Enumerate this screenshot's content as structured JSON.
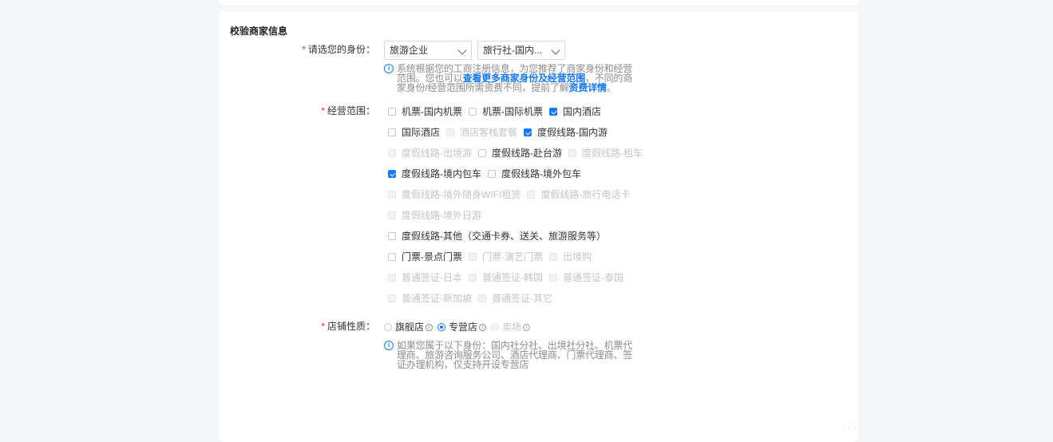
{
  "section_title": "校验商家信息",
  "identity": {
    "label": "请选您的身份：",
    "select1": "旅游企业",
    "select2": "旅行社-国内...",
    "hint_prefix": "系统根据您的工商注册信息，为您推荐了商家身份和经营范围。您也可以",
    "hint_link": "查看更多商家身份及经营范围",
    "hint_mid": "，不同的商家身份/经营范围所需资费不同，提前了解",
    "hint_link2": "资费详情",
    "hint_suffix": "。"
  },
  "scope": {
    "label": "经营范围：",
    "rows": [
      [
        {
          "label": "机票-国内机票",
          "checked": false,
          "disabled": false
        },
        {
          "label": "机票-国际机票",
          "checked": false,
          "disabled": false
        },
        {
          "label": "国内酒店",
          "checked": true,
          "disabled": false
        }
      ],
      [
        {
          "label": "国际酒店",
          "checked": false,
          "disabled": false
        },
        {
          "label": "酒店客栈套餐",
          "checked": false,
          "disabled": true
        },
        {
          "label": "度假线路-国内游",
          "checked": true,
          "disabled": false
        }
      ],
      [
        {
          "label": "度假线路-出境游",
          "checked": false,
          "disabled": true
        },
        {
          "label": "度假线路-赴台游",
          "checked": false,
          "disabled": false
        },
        {
          "label": "度假线路-租车",
          "checked": false,
          "disabled": true
        }
      ],
      [
        {
          "label": "度假线路-境内包车",
          "checked": true,
          "disabled": false
        },
        {
          "label": "度假线路-境外包车",
          "checked": false,
          "disabled": false
        }
      ],
      [
        {
          "label": "度假线路-境外随身WIFI租赁",
          "checked": false,
          "disabled": true
        },
        {
          "label": "度假线路-旅行电话卡",
          "checked": false,
          "disabled": true
        }
      ],
      [
        {
          "label": "度假线路-境外日游",
          "checked": false,
          "disabled": true
        }
      ],
      [
        {
          "label": "度假线路-其他（交通卡券、送关、旅游服务等）",
          "checked": false,
          "disabled": false
        }
      ],
      [
        {
          "label": "门票-景点门票",
          "checked": false,
          "disabled": false
        },
        {
          "label": "门票-演艺门票",
          "checked": false,
          "disabled": true
        },
        {
          "label": "出境购",
          "checked": false,
          "disabled": true
        }
      ],
      [
        {
          "label": "普通签证-日本",
          "checked": false,
          "disabled": true
        },
        {
          "label": "普通签证-韩国",
          "checked": false,
          "disabled": true
        },
        {
          "label": "普通签证-泰国",
          "checked": false,
          "disabled": true
        }
      ],
      [
        {
          "label": "普通签证-新加坡",
          "checked": false,
          "disabled": true
        },
        {
          "label": "普通签证-其它",
          "checked": false,
          "disabled": true
        }
      ]
    ]
  },
  "store": {
    "label": "店铺性质：",
    "options": [
      {
        "label": "旗舰店",
        "checked": false,
        "disabled": false
      },
      {
        "label": "专营店",
        "checked": true,
        "disabled": false
      },
      {
        "label": "卖场",
        "checked": false,
        "disabled": true
      }
    ],
    "hint": "如果您属于以下身份：国内社分社、出境社分社、机票代理商、旅游咨询服务公司、酒店代理商、门票代理商、签证办理机构，仅支持开设专营店"
  },
  "colors": {
    "accent": "#1677ff",
    "required": "#f5222d",
    "disabled_text": "#c4c4c4"
  }
}
